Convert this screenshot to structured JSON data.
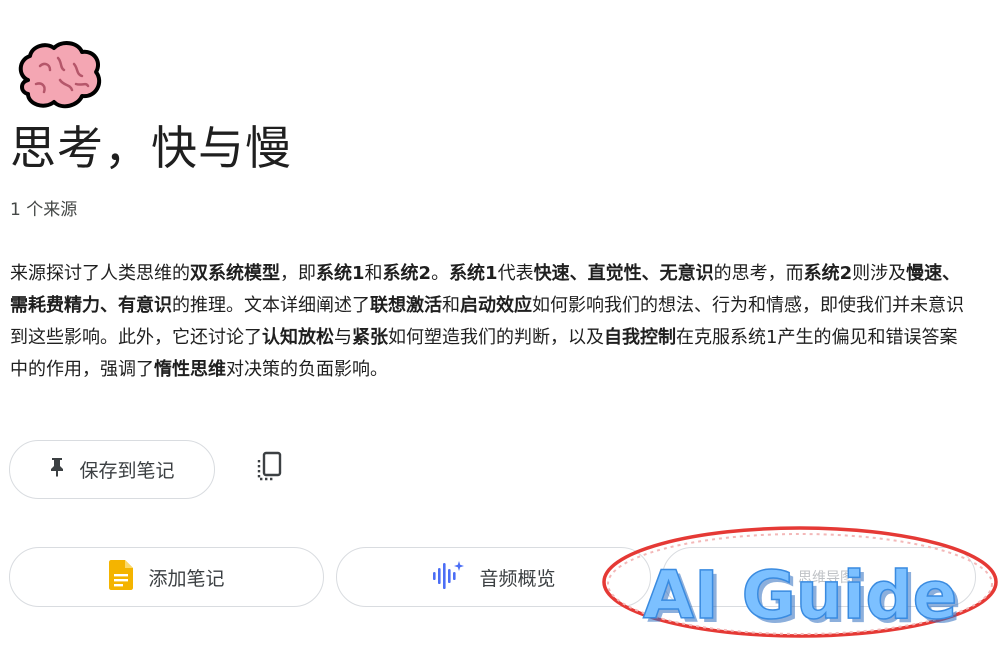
{
  "notebook": {
    "emoji_icon": "brain-icon",
    "title": "思考，快与慢",
    "source_count": "1 个来源"
  },
  "summary": {
    "segments": [
      {
        "text": "来源探讨了人类思维的",
        "bold": false
      },
      {
        "text": "双系统模型",
        "bold": true
      },
      {
        "text": "，即",
        "bold": false
      },
      {
        "text": "系统1",
        "bold": true
      },
      {
        "text": "和",
        "bold": false
      },
      {
        "text": "系统2",
        "bold": true
      },
      {
        "text": "。",
        "bold": false
      },
      {
        "text": "系统1",
        "bold": true
      },
      {
        "text": "代表",
        "bold": false
      },
      {
        "text": "快速、直觉性、无意识",
        "bold": true
      },
      {
        "text": "的思考，而",
        "bold": false
      },
      {
        "text": "系统2",
        "bold": true
      },
      {
        "text": "则涉及",
        "bold": false
      },
      {
        "text": "慢速、需耗费精力、有意识",
        "bold": true
      },
      {
        "text": "的推理。文本详细阐述了",
        "bold": false
      },
      {
        "text": "联想激活",
        "bold": true
      },
      {
        "text": "和",
        "bold": false
      },
      {
        "text": "启动效应",
        "bold": true
      },
      {
        "text": "如何影响我们的想法、行为和情感，即使我们并未意识到这些影响。此外，它还讨论了",
        "bold": false
      },
      {
        "text": "认知放松",
        "bold": true
      },
      {
        "text": "与",
        "bold": false
      },
      {
        "text": "紧张",
        "bold": true
      },
      {
        "text": "如何塑造我们的判断，以及",
        "bold": false
      },
      {
        "text": "自我控制",
        "bold": true
      },
      {
        "text": "在克服系统1产生的偏见和错误答案中的作用，强调了",
        "bold": false
      },
      {
        "text": "惰性思维",
        "bold": true
      },
      {
        "text": "对决策的负面影响。",
        "bold": false
      }
    ]
  },
  "buttons": {
    "save_to_note": "保存到笔记",
    "save_icon": "pin-icon",
    "copy_icon": "copy-icon",
    "add_note": "添加笔记",
    "add_note_icon": "note-icon",
    "audio_overview": "音频概览",
    "audio_icon": "audio-waveform-icon",
    "third_action": "思维导图"
  },
  "watermark": {
    "text": "AI Guide"
  },
  "colors": {
    "note_icon": "#f4b400",
    "audio_icon": "#4c6ef5",
    "brain_pink": "#f4a6b3",
    "watermark_ring": "#e53935",
    "watermark_text": "#5aa9f0"
  }
}
